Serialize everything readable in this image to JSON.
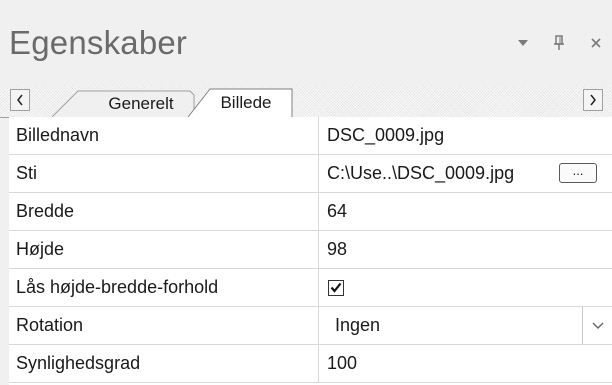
{
  "panel": {
    "title": "Egenskaber",
    "dropdown_icon": "triangle-down-icon",
    "pin_icon": "pin-icon",
    "close_icon": "close-icon"
  },
  "tabs": [
    {
      "label": "Generelt",
      "active": false
    },
    {
      "label": "Billede",
      "active": true
    }
  ],
  "properties": [
    {
      "name": "Billednavn",
      "value": "DSC_0009.jpg"
    },
    {
      "name": "Sti",
      "value": "C:\\Use..\\DSC_0009.jpg",
      "button_label": "..."
    },
    {
      "name": "Bredde",
      "value": "64"
    },
    {
      "name": "Højde",
      "value": "98"
    },
    {
      "name": "Lås højde-bredde-forhold",
      "checked": true
    },
    {
      "name": "Rotation",
      "value": "Ingen"
    },
    {
      "name": "Synlighedsgrad",
      "value": "100"
    }
  ],
  "colors": {
    "background": "#f0f0f0",
    "title_text": "#6a6a6a",
    "grid_line": "#d8d8d8"
  }
}
